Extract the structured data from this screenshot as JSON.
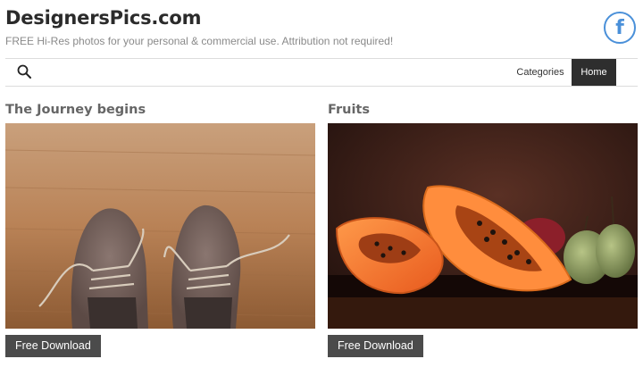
{
  "site": {
    "title": "DesignersPics.com",
    "tagline": "FREE Hi-Res photos for your personal & commercial use. Attribution not required!"
  },
  "social": {
    "facebook_glyph": "f",
    "icon": "facebook-icon",
    "color": "#4a90d9"
  },
  "nav": {
    "search_icon": "search-icon",
    "items": [
      {
        "label": "Categories",
        "active": false
      },
      {
        "label": "Home",
        "active": true
      }
    ]
  },
  "posts": [
    {
      "title": "The Journey begins",
      "image": "leather shoes with untied laces on wooden floor",
      "button": "Free Download"
    },
    {
      "title": "Fruits",
      "image": "halved papayas and pears on dark reflective surface",
      "button": "Free Download"
    }
  ]
}
